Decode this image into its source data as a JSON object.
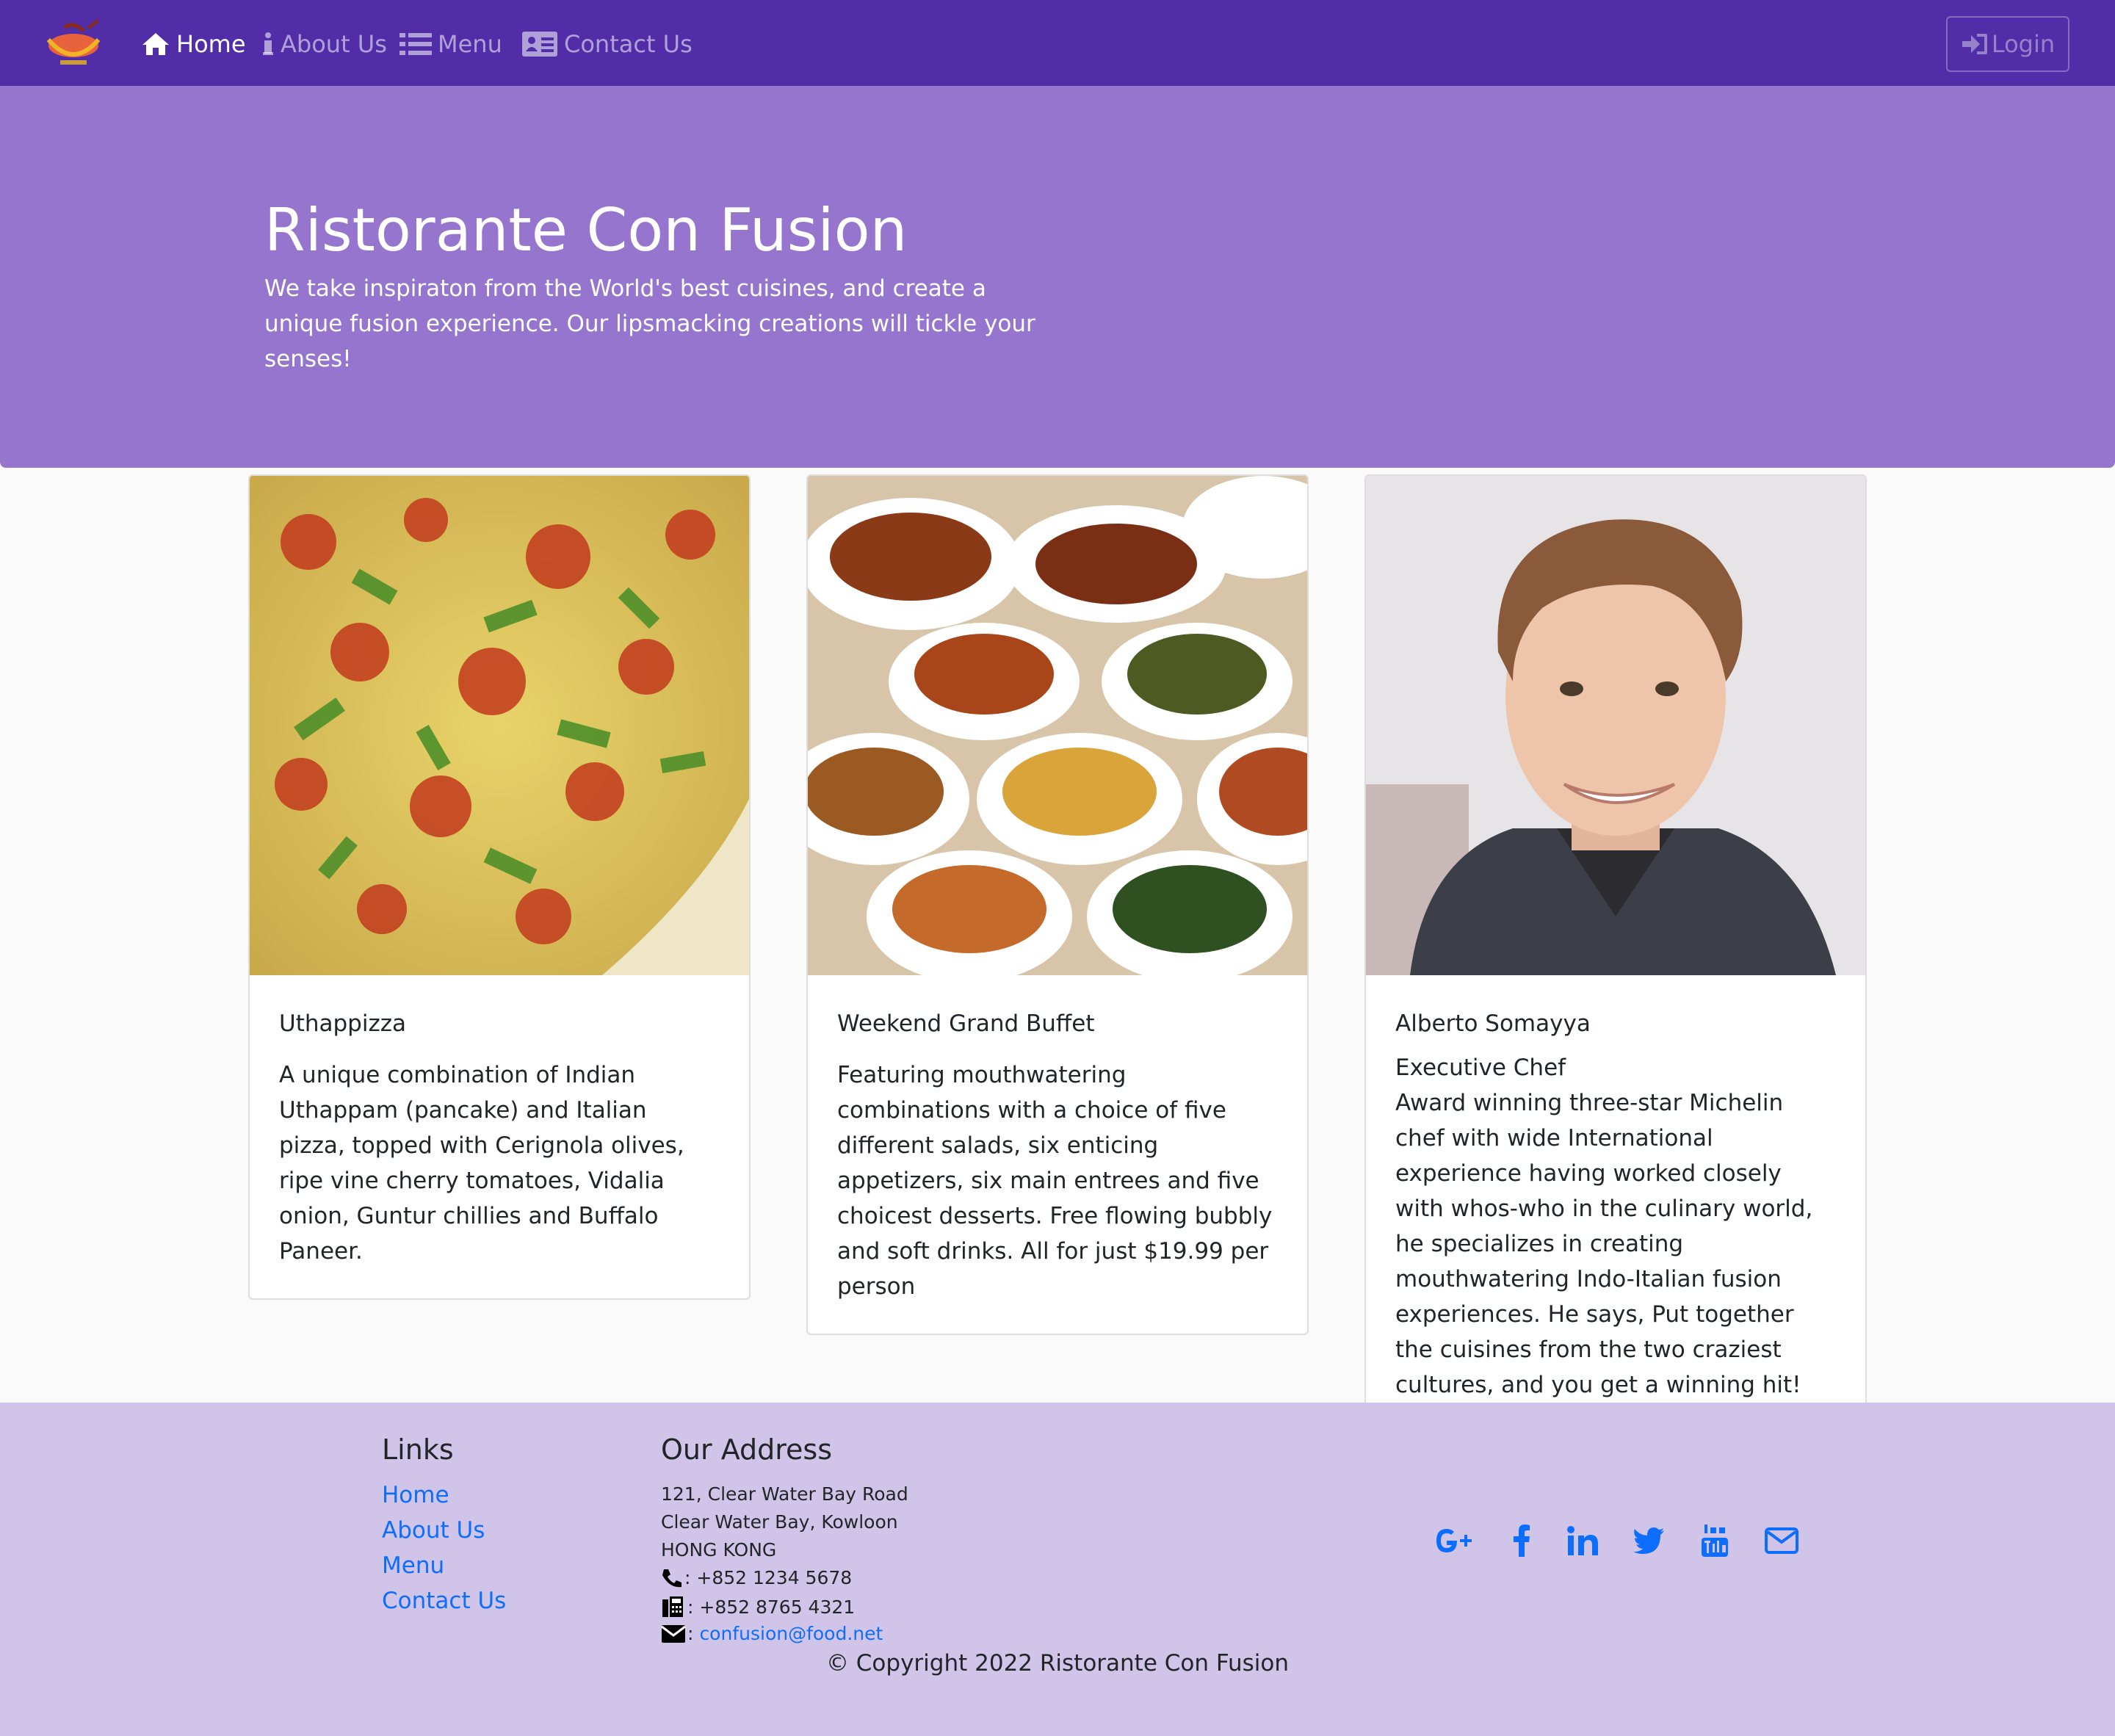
{
  "navbar": {
    "items": [
      {
        "label": "Home",
        "active": true
      },
      {
        "label": "About Us",
        "active": false
      },
      {
        "label": "Menu",
        "active": false
      },
      {
        "label": "Contact Us",
        "active": false
      }
    ],
    "login_label": "Login"
  },
  "jumbotron": {
    "title": "Ristorante Con Fusion",
    "text": "We take inspiraton from the World's best cuisines, and create a unique fusion experience. Our lipsmacking creations will tickle your senses!"
  },
  "cards": [
    {
      "title": "Uthappizza",
      "text": "A unique combination of Indian Uthappam (pancake) and Italian pizza, topped with Cerignola olives, ripe vine cherry tomatoes, Vidalia onion, Guntur chillies and Buffalo Paneer."
    },
    {
      "title": "Weekend Grand Buffet",
      "text": "Featuring mouthwatering combinations with a choice of five different salads, six enticing appetizers, six main entrees and five choicest desserts. Free flowing bubbly and soft drinks. All for just $19.99 per person"
    },
    {
      "title": "Alberto Somayya",
      "subtitle": "Executive Chef",
      "text": "Award winning three-star Michelin chef with wide International experience having worked closely with whos-who in the culinary world, he specializes in creating mouthwatering Indo-Italian fusion experiences. He says, Put together the cuisines from the two craziest cultures, and you get a winning hit! Amma Mia!"
    }
  ],
  "footer": {
    "links_heading": "Links",
    "links": [
      "Home",
      "About Us",
      "Menu",
      "Contact Us"
    ],
    "address_heading": "Our Address",
    "address": [
      "121, Clear Water Bay Road",
      "Clear Water Bay, Kowloon",
      "HONG KONG"
    ],
    "phone": ": +852 1234 5678",
    "fax": ": +852 8765 4321",
    "email_prefix": ":",
    "email": "confusion@food.net",
    "social_icons": [
      "google-plus-icon",
      "facebook-icon",
      "linkedin-icon",
      "twitter-icon",
      "youtube-icon",
      "envelope-icon"
    ],
    "copyright": "© Copyright 2022 Ristorante Con Fusion"
  },
  "colors": {
    "navbar": "#512DA8",
    "jumbotron": "#9575CD",
    "footer": "#D1C4E9",
    "link": "#0d6efd"
  }
}
